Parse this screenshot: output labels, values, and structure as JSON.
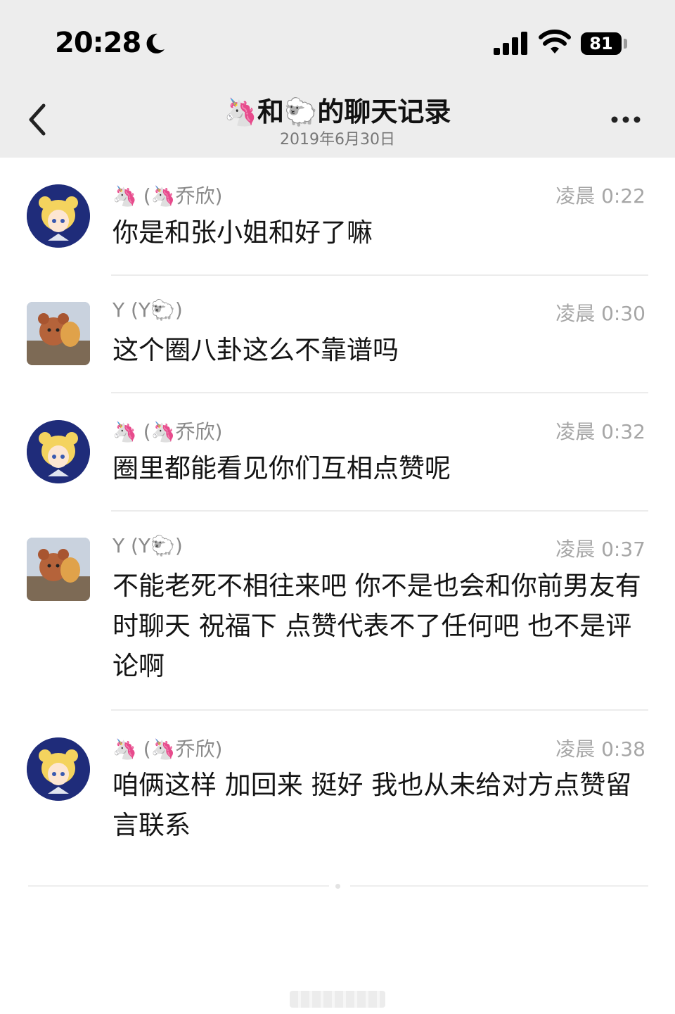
{
  "status_bar": {
    "time": "20:28",
    "moon_icon": "moon-icon",
    "signal_icon": "cellular-signal-icon",
    "wifi_icon": "wifi-icon",
    "battery": "81"
  },
  "nav": {
    "back_icon": "chevron-left-icon",
    "title_left_emoji": "🦄",
    "title_joiner": "和",
    "title_right_emoji": "🐑",
    "title_suffix": "的聊天记录",
    "subtitle": "2019年6月30日",
    "more_icon": "more-dots-icon"
  },
  "messages": [
    {
      "sender": "🦄 (🦄乔欣)",
      "time": "凌晨 0:22",
      "text": "你是和张小姐和好了嘛",
      "avatar": "sailor-moon-avatar"
    },
    {
      "sender": "Y (Y🐑)",
      "time": "凌晨 0:30",
      "text": "这个圈八卦这么不靠谱吗",
      "avatar": "bear-avatar"
    },
    {
      "sender": "🦄 (🦄乔欣)",
      "time": "凌晨 0:32",
      "text": "圈里都能看见你们互相点赞呢",
      "avatar": "sailor-moon-avatar"
    },
    {
      "sender": "Y (Y🐑)",
      "time": "凌晨 0:37",
      "text": "不能老死不相往来吧 你不是也会和你前男友有时聊天 祝福下 点赞代表不了任何吧 也不是评论啊",
      "avatar": "bear-avatar"
    },
    {
      "sender": "🦄 (🦄乔欣)",
      "time": "凌晨 0:38",
      "text": "咱俩这样 加回来 挺好  我也从未给对方点赞留言联系",
      "avatar": "sailor-moon-avatar"
    }
  ],
  "colors": {
    "header_bg": "#ededed",
    "time_text": "#a6a6a6",
    "sender_text": "#8a8a8a",
    "body_text": "#141414"
  }
}
